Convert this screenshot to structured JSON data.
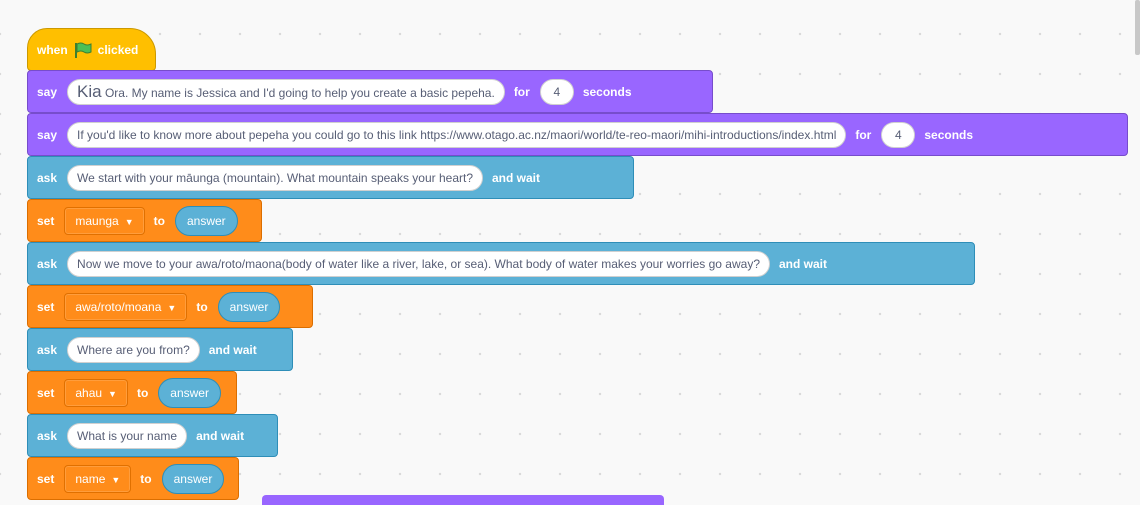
{
  "blocks": {
    "hat": {
      "when": "when",
      "clicked": "clicked"
    },
    "say1": {
      "keyword": "say",
      "message_lead": "Kia",
      "message": "Ora.  My name is Jessica and I'd going to help you create a basic pepeha.",
      "for": "for",
      "seconds_value": "4",
      "seconds": "seconds"
    },
    "say2": {
      "keyword": "say",
      "message": "If you'd like to know more about pepeha you could go to this link https://www.otago.ac.nz/maori/world/te-reo-maori/mihi-introductions/index.html",
      "for": "for",
      "seconds_value": "4",
      "seconds": "seconds"
    },
    "ask1": {
      "keyword": "ask",
      "question": "We start with your māunga (mountain).  What mountain speaks your heart?",
      "and_wait": "and wait"
    },
    "set1": {
      "keyword": "set",
      "variable": "maunga",
      "to": "to",
      "value": "answer"
    },
    "ask2": {
      "keyword": "ask",
      "question": "Now we move to your awa/roto/maona(body of water like a river, lake, or sea).  What body of water makes your worries go away?",
      "and_wait": "and wait"
    },
    "set2": {
      "keyword": "set",
      "variable": "awa/roto/moana",
      "to": "to",
      "value": "answer"
    },
    "ask3": {
      "keyword": "ask",
      "question": "Where are you from?",
      "and_wait": "and wait"
    },
    "set3": {
      "keyword": "set",
      "variable": "ahau",
      "to": "to",
      "value": "answer"
    },
    "ask4": {
      "keyword": "ask",
      "question": "What is your name",
      "and_wait": "and wait"
    },
    "set4": {
      "keyword": "set",
      "variable": "name",
      "to": "to",
      "value": "answer"
    }
  },
  "colors": {
    "events": "#ffbf00",
    "looks": "#9966ff",
    "sensing": "#5cb1d6",
    "variables": "#ff8c1a",
    "workspace": "#f9f9f9"
  },
  "icons": {
    "flag": "green-flag-icon",
    "dropdown": "caret-down-icon"
  }
}
